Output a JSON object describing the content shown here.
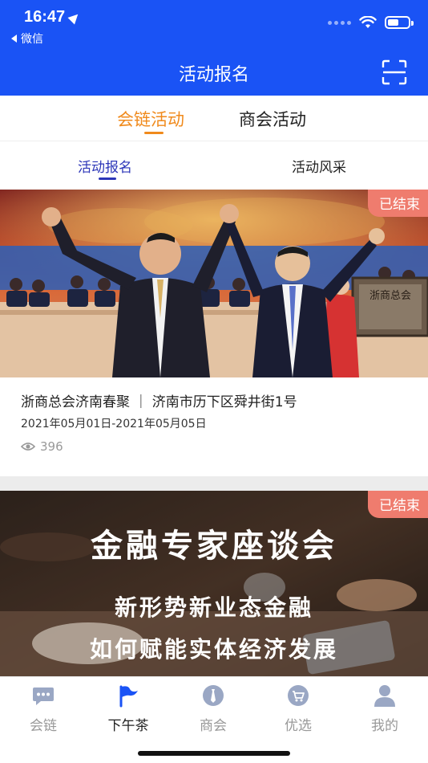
{
  "status_bar": {
    "time": "16:47",
    "back_app": "微信"
  },
  "header": {
    "title": "活动报名"
  },
  "primary_tabs": [
    {
      "label": "会链活动",
      "active": true
    },
    {
      "label": "商会活动",
      "active": false
    }
  ],
  "secondary_tabs": [
    {
      "label": "活动报名",
      "active": true
    },
    {
      "label": "活动风采",
      "active": false
    }
  ],
  "events": [
    {
      "badge": "已结束",
      "title": "浙商总会济南春聚 ｜ 济南市历下区舜井街1号",
      "date": "2021年05月01日-2021年05月05日",
      "views": "396",
      "photo_sign": "浙商总会"
    },
    {
      "badge": "已结束",
      "poster_title": "金融专家座谈会",
      "poster_line1": "新形势新业态金融",
      "poster_line2": "如何赋能实体经济发展"
    }
  ],
  "tabbar": [
    {
      "label": "会链",
      "icon": "chat-bubble-icon",
      "active": false
    },
    {
      "label": "下午茶",
      "icon": "flag-icon",
      "active": true
    },
    {
      "label": "商会",
      "icon": "tie-icon",
      "active": false
    },
    {
      "label": "优选",
      "icon": "cart-icon",
      "active": false
    },
    {
      "label": "我的",
      "icon": "person-icon",
      "active": false
    }
  ],
  "colors": {
    "brand_blue": "#1a53f5",
    "tab_orange": "#f08a1c",
    "subtab_indigo": "#2c36b8",
    "badge_red": "#ef7c6e"
  }
}
